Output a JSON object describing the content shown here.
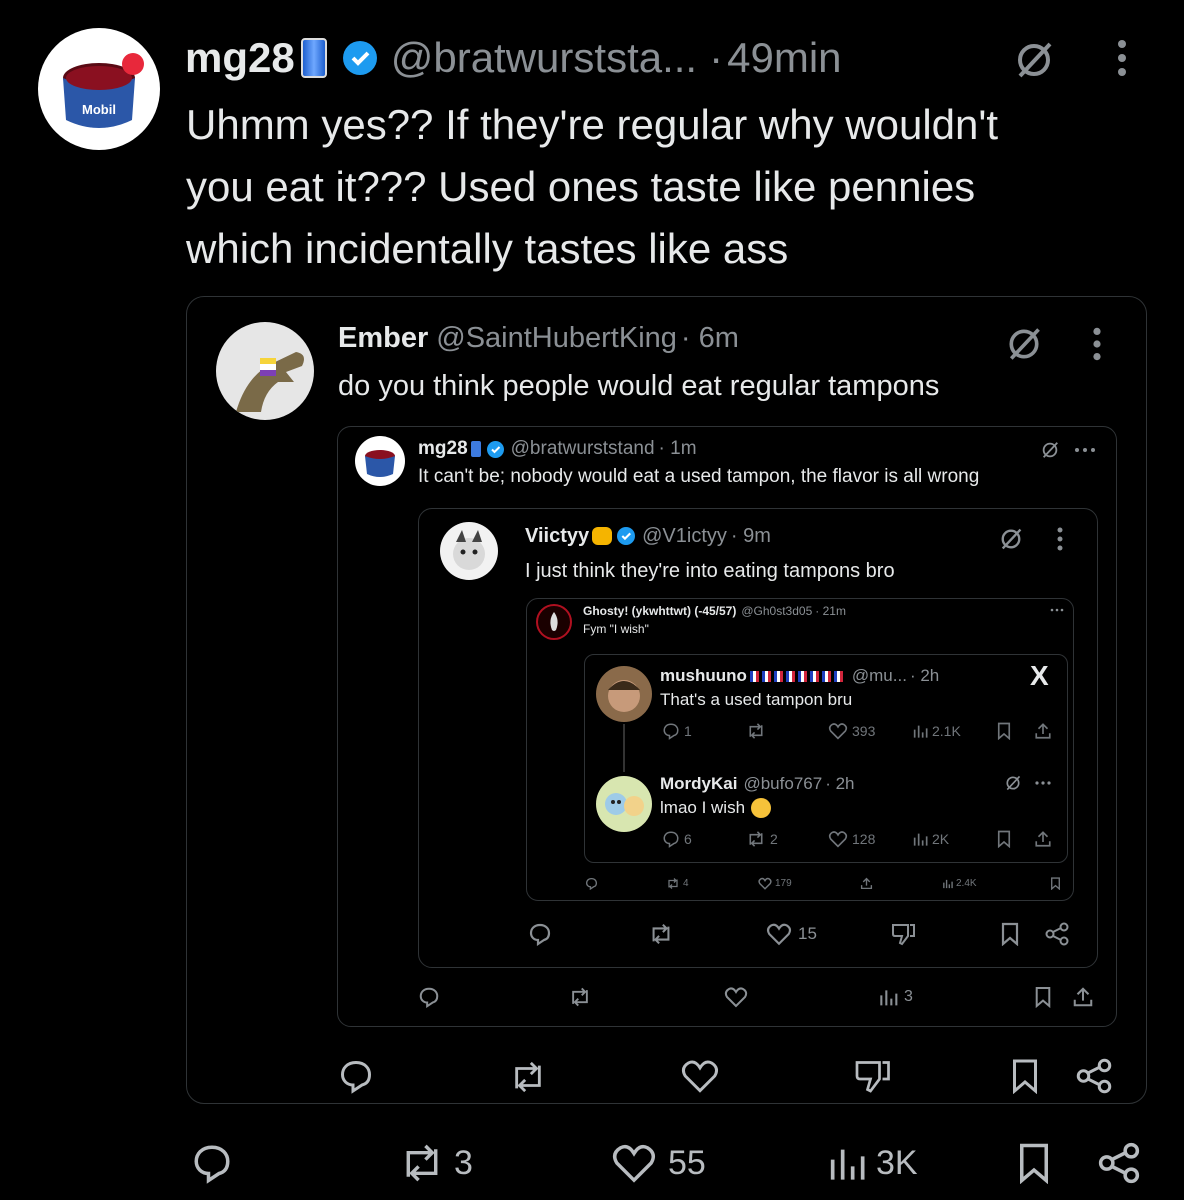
{
  "main_post": {
    "display_name": "mg28",
    "handle": "@bratwurststa...",
    "separator": "·",
    "time": "49min",
    "text_lines": [
      "Uhmm yes?? If they're regular why wouldn't",
      "you eat it??? Used ones taste like pennies",
      "which incidentally tastes like ass"
    ],
    "actions": {
      "reposts": "3",
      "likes": "55",
      "views": "3K"
    }
  },
  "quote1": {
    "display_name": "Ember",
    "handle": "@SaintHubertKing",
    "time": "· 6m",
    "text": "do you think people would eat regular tampons"
  },
  "quote2": {
    "display_name": "mg28",
    "handle": "@bratwurststand",
    "time": "· 1m",
    "text": "It can't be; nobody would eat a used tampon, the flavor is all wrong",
    "actions": {
      "views": "3"
    }
  },
  "quote3": {
    "display_name": "Viictyy",
    "handle": "@V1ictyy",
    "time": "· 9m",
    "text": "I just think they're into eating tampons bro",
    "actions": {
      "likes": "15"
    }
  },
  "quote4": {
    "display_name": "Ghosty! (ykwhttwt) (-45/57)",
    "handle": "@Gh0st3d05",
    "time": "· 21m",
    "text": "Fym \"I wish\"",
    "actions": {
      "reposts": "4",
      "likes": "179",
      "views": "2.4K"
    }
  },
  "reply_a": {
    "display_name": "mushuuno",
    "handle": "@mu...",
    "time": "· 2h",
    "text": "That's a used tampon bru",
    "actions": {
      "replies": "1",
      "likes": "393",
      "views": "2.1K"
    }
  },
  "reply_b": {
    "display_name": "MordyKai",
    "handle": "@bufo767",
    "time": "· 2h",
    "text": "lmao I wish",
    "actions": {
      "replies": "6",
      "reposts": "2",
      "likes": "128",
      "views": "2K"
    }
  },
  "badges": {
    "x_logo": "X",
    "flags_count": "8"
  },
  "colors": {
    "verified": "#1d9bf0",
    "background": "#000000",
    "muted": "#71767b"
  }
}
